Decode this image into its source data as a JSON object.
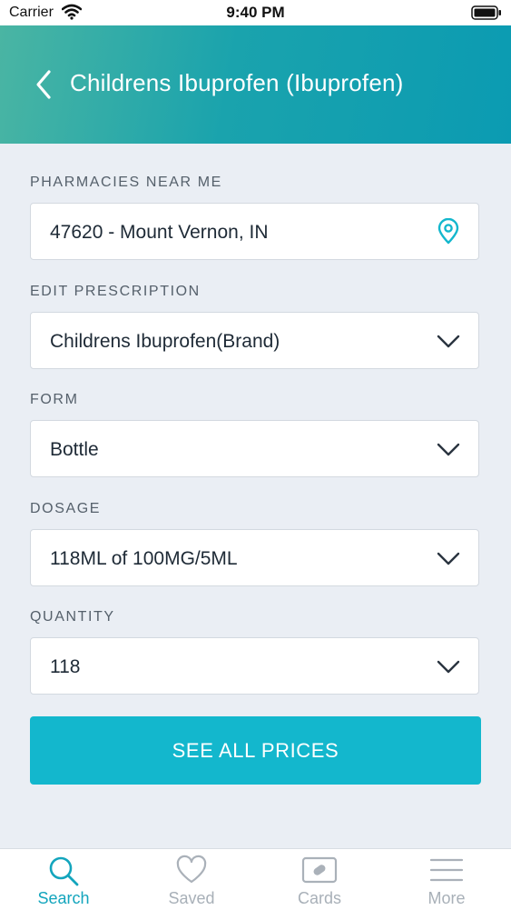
{
  "status_bar": {
    "carrier": "Carrier",
    "time": "9:40 PM"
  },
  "header": {
    "title": "Childrens Ibuprofen (Ibuprofen)"
  },
  "form": {
    "pharmacies_label": "PHARMACIES NEAR ME",
    "pharmacies_value": "47620 - Mount Vernon, IN",
    "prescription_label": "EDIT PRESCRIPTION",
    "prescription_value": "Childrens Ibuprofen(Brand)",
    "form_label": "FORM",
    "form_value": "Bottle",
    "dosage_label": "DOSAGE",
    "dosage_value": "118ML of 100MG/5ML",
    "quantity_label": "QUANTITY",
    "quantity_value": "118"
  },
  "cta": {
    "label": "SEE ALL PRICES"
  },
  "tabs": [
    {
      "label": "Search",
      "icon": "search-icon",
      "active": true
    },
    {
      "label": "Saved",
      "icon": "heart-icon",
      "active": false
    },
    {
      "label": "Cards",
      "icon": "card-icon",
      "active": false
    },
    {
      "label": "More",
      "icon": "menu-icon",
      "active": false
    }
  ],
  "colors": {
    "accent": "#13b7cd",
    "header_start": "#4ab5a3",
    "header_end": "#0b9bb2",
    "active_tab": "#13a5bd"
  }
}
